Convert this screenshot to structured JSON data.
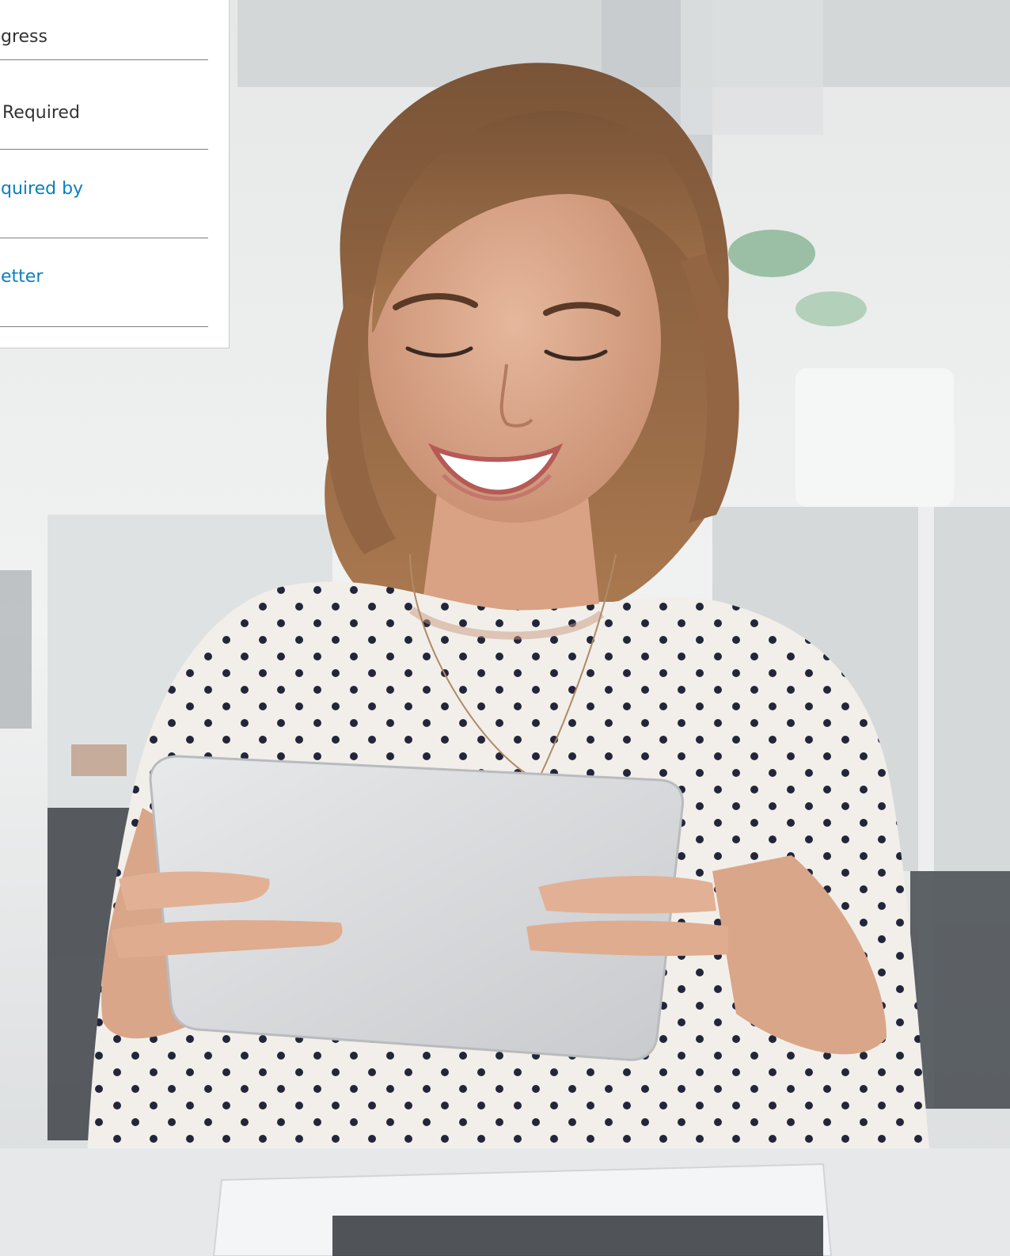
{
  "menu": {
    "items": [
      {
        "label": "gress",
        "style": "dark"
      },
      {
        "label": "Required",
        "style": "dark"
      },
      {
        "label": "quired by",
        "style": "link"
      },
      {
        "label": "etter",
        "style": "link"
      }
    ]
  },
  "colors": {
    "link": "#0a7fc0",
    "text": "#333333",
    "divider": "#7f7f7f",
    "card_border": "#c9c9c9"
  }
}
